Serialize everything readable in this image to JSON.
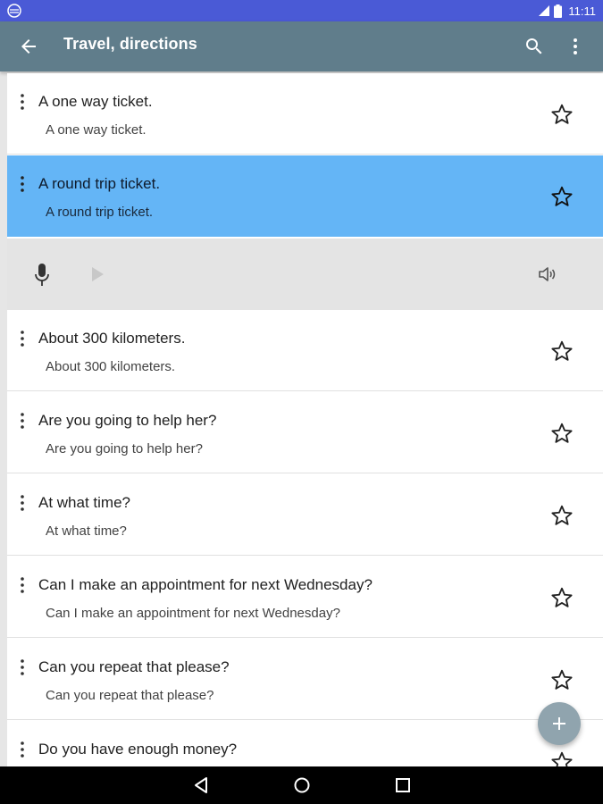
{
  "status_bar": {
    "time": "11:11",
    "icons": [
      "app-notification-icon",
      "signal-icon",
      "battery-icon"
    ]
  },
  "toolbar": {
    "title": "Travel, directions",
    "back_icon": "arrow-back-icon",
    "search_icon": "search-icon",
    "more_icon": "more-vert-icon"
  },
  "phrases": [
    {
      "primary": "A one way ticket.",
      "secondary": "A one way ticket.",
      "starred": false
    },
    {
      "primary": "A round trip ticket.",
      "secondary": "A round trip ticket.",
      "starred": false,
      "selected": true
    },
    {
      "primary": "About 300 kilometers.",
      "secondary": "About 300 kilometers.",
      "starred": false
    },
    {
      "primary": "Are you going to help her?",
      "secondary": "Are you going to help her?",
      "starred": false
    },
    {
      "primary": "At what time?",
      "secondary": "At what time?",
      "starred": false
    },
    {
      "primary": "Can I make an appointment for next Wednesday?",
      "secondary": "Can I make an appointment for next Wednesday?",
      "starred": false
    },
    {
      "primary": "Can you repeat that please?",
      "secondary": "Can you repeat that please?",
      "starred": false
    },
    {
      "primary": "Do you have enough money?",
      "secondary": "",
      "starred": false
    }
  ],
  "player": {
    "icons": [
      "microphone-icon",
      "play-icon",
      "speaker-icon"
    ]
  },
  "fab": {
    "icon": "add-icon"
  },
  "nav_bar": {
    "icons": [
      "nav-back-icon",
      "nav-home-icon",
      "nav-recents-icon"
    ]
  },
  "colors": {
    "status_bar": "#4a5ad6",
    "toolbar": "#607d8b",
    "selected_row": "#64b5f6",
    "player_bg": "#e4e4e4",
    "fab": "#90a4ae"
  }
}
